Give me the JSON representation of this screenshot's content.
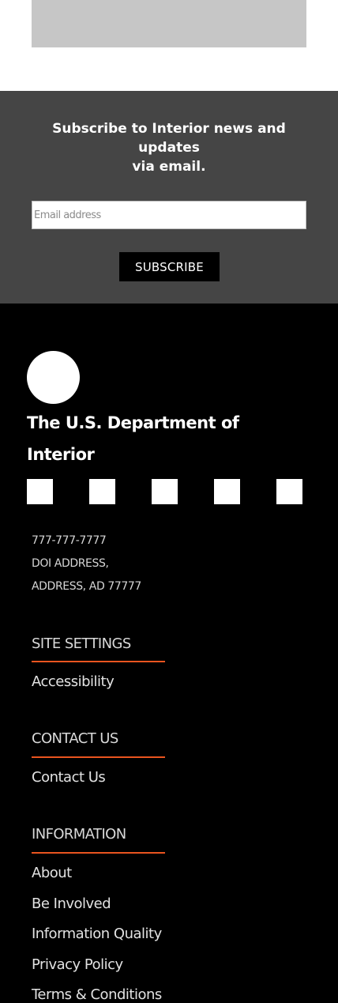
{
  "subscribe": {
    "title_line1": "Subscribe to Interior news and",
    "title_line2": "updates",
    "title_line3": "via email.",
    "email_placeholder": "Email address",
    "button_label": "SUBSCRIBE"
  },
  "footer": {
    "department_name": "The U.S. Department of Interior",
    "phone": "777-777-7777",
    "address_line1": "DOI ADDRESS,",
    "address_line2": "ADDRESS, AD 77777",
    "sections": {
      "site_settings": {
        "heading": "SITE SETTINGS",
        "links": [
          "Accessibility"
        ]
      },
      "contact_us": {
        "heading": "CONTACT US",
        "links": [
          "Contact Us"
        ]
      },
      "information": {
        "heading": "INFORMATION",
        "links": [
          "About",
          "Be Involved",
          "Information Quality",
          "Privacy Policy",
          "Terms & Conditions"
        ]
      }
    },
    "accent_color": "#e9541f"
  }
}
